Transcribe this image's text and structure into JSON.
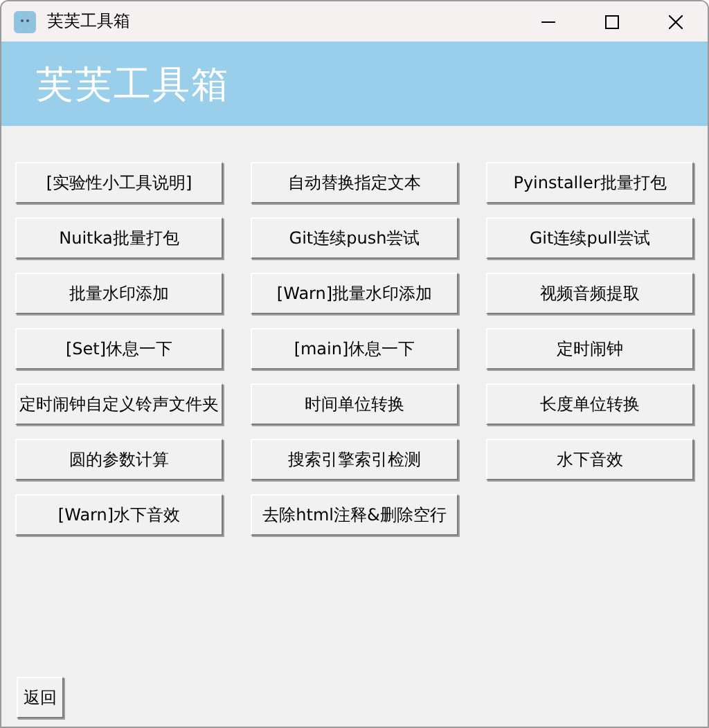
{
  "window": {
    "title": "芙芙工具箱"
  },
  "banner": {
    "title": "芙芙工具箱"
  },
  "tools": [
    "[实验性小工具说明]",
    "自动替换指定文本",
    "Pyinstaller批量打包",
    "Nuitka批量打包",
    "Git连续push尝试",
    "Git连续pull尝试",
    "批量水印添加",
    "[Warn]批量水印添加",
    "视频音频提取",
    "[Set]休息一下",
    "[main]休息一下",
    "定时闹钟",
    "定时闹钟自定义铃声文件夹",
    "时间单位转换",
    "长度单位转换",
    "圆的参数计算",
    "搜索引擎索引检测",
    "水下音效",
    "[Warn]水下音效",
    "去除html注释&删除空行"
  ],
  "back_button": "返回"
}
